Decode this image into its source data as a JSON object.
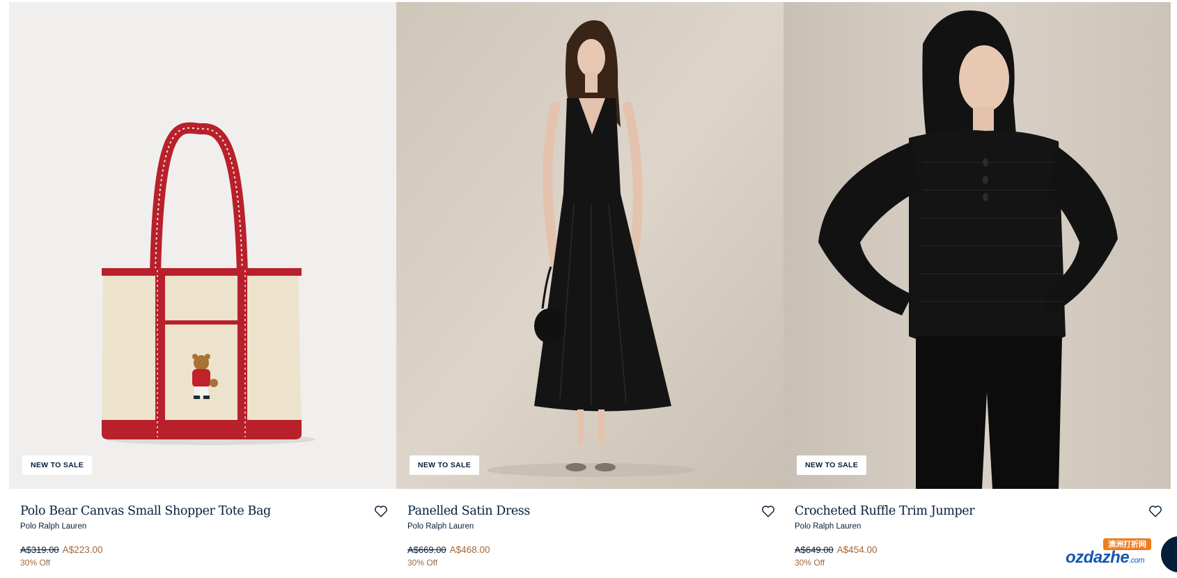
{
  "products": [
    {
      "image_alt": "tote-bag-image",
      "badge": "NEW TO SALE",
      "title": "Polo Bear Canvas Small Shopper Tote Bag",
      "brand": "Polo Ralph Lauren",
      "price_original": "A$319.00",
      "price_sale": "A$223.00",
      "discount": "30% Off",
      "wishlist_icon": "heart-icon"
    },
    {
      "image_alt": "satin-dress-image",
      "badge": "NEW TO SALE",
      "title": "Panelled Satin Dress",
      "brand": "Polo Ralph Lauren",
      "price_original": "A$669.00",
      "price_sale": "A$468.00",
      "discount": "30% Off",
      "wishlist_icon": "heart-icon"
    },
    {
      "image_alt": "crocheted-jumper-image",
      "badge": "NEW TO SALE",
      "title": "Crocheted Ruffle Trim Jumper",
      "brand": "Polo Ralph Lauren",
      "price_original": "A$649.00",
      "price_sale": "A$454.00",
      "discount": "30% Off",
      "wishlist_icon": "heart-icon"
    }
  ],
  "watermark": {
    "cn_label": "澳洲打折网",
    "brand": "ozdazhe",
    "suffix": ".com"
  },
  "colors": {
    "navy": "#041e3a",
    "sale": "#a0683a",
    "bag_red": "#b8202c",
    "canvas": "#ede3cc"
  }
}
